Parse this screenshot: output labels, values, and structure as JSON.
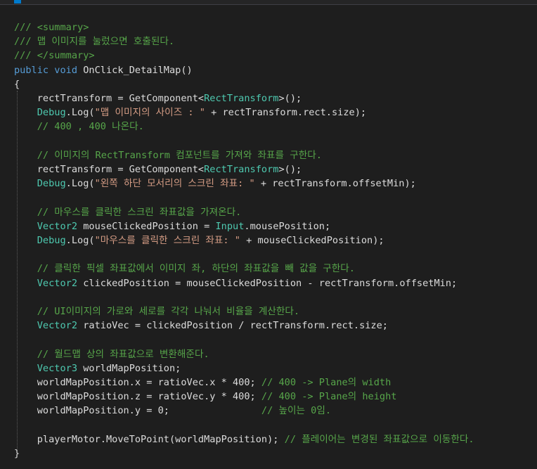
{
  "colors": {
    "background": "#1e1e1e",
    "plain": "#dcdcdc",
    "comment": "#57a64a",
    "keyword": "#569cd6",
    "type": "#4ec9b0",
    "string": "#d69d85"
  },
  "code": {
    "lines": [
      [
        {
          "c": "comment",
          "t": "/// <summary>"
        }
      ],
      [
        {
          "c": "comment",
          "t": "/// 맵 이미지를 눌렀으면 호출된다."
        }
      ],
      [
        {
          "c": "comment",
          "t": "/// </summary>"
        }
      ],
      [
        {
          "c": "keyword",
          "t": "public"
        },
        {
          "c": "plain",
          "t": " "
        },
        {
          "c": "keyword",
          "t": "void"
        },
        {
          "c": "plain",
          "t": " OnClick_DetailMap()"
        }
      ],
      [
        {
          "c": "plain",
          "t": "{"
        }
      ],
      [
        {
          "c": "plain",
          "t": "    rectTransform = GetComponent<"
        },
        {
          "c": "type",
          "t": "RectTransform"
        },
        {
          "c": "plain",
          "t": ">();"
        }
      ],
      [
        {
          "c": "plain",
          "t": "    "
        },
        {
          "c": "type",
          "t": "Debug"
        },
        {
          "c": "plain",
          "t": ".Log("
        },
        {
          "c": "string",
          "t": "\"맵 이미지의 사이즈 : \""
        },
        {
          "c": "plain",
          "t": " + rectTransform.rect.size);"
        }
      ],
      [
        {
          "c": "plain",
          "t": "    "
        },
        {
          "c": "comment",
          "t": "// 400 , 400 나온다."
        }
      ],
      [],
      [
        {
          "c": "plain",
          "t": "    "
        },
        {
          "c": "comment",
          "t": "// 이미지의 RectTransform 컴포넌트를 가져와 좌표를 구한다."
        }
      ],
      [
        {
          "c": "plain",
          "t": "    rectTransform = GetComponent<"
        },
        {
          "c": "type",
          "t": "RectTransform"
        },
        {
          "c": "plain",
          "t": ">();"
        }
      ],
      [
        {
          "c": "plain",
          "t": "    "
        },
        {
          "c": "type",
          "t": "Debug"
        },
        {
          "c": "plain",
          "t": ".Log("
        },
        {
          "c": "string",
          "t": "\"왼쪽 하단 모서리의 스크린 좌표: \""
        },
        {
          "c": "plain",
          "t": " + rectTransform.offsetMin);"
        }
      ],
      [],
      [
        {
          "c": "plain",
          "t": "    "
        },
        {
          "c": "comment",
          "t": "// 마우스를 클릭한 스크린 좌표값을 가져온다."
        }
      ],
      [
        {
          "c": "plain",
          "t": "    "
        },
        {
          "c": "type",
          "t": "Vector2"
        },
        {
          "c": "plain",
          "t": " mouseClickedPosition = "
        },
        {
          "c": "type",
          "t": "Input"
        },
        {
          "c": "plain",
          "t": ".mousePosition;"
        }
      ],
      [
        {
          "c": "plain",
          "t": "    "
        },
        {
          "c": "type",
          "t": "Debug"
        },
        {
          "c": "plain",
          "t": ".Log("
        },
        {
          "c": "string",
          "t": "\"마우스를 클릭한 스크린 좌표: \""
        },
        {
          "c": "plain",
          "t": " + mouseClickedPosition);"
        }
      ],
      [],
      [
        {
          "c": "plain",
          "t": "    "
        },
        {
          "c": "comment",
          "t": "// 클릭한 픽셀 좌표값에서 이미지 좌, 하단의 좌표값을 빼 값을 구한다."
        }
      ],
      [
        {
          "c": "plain",
          "t": "    "
        },
        {
          "c": "type",
          "t": "Vector2"
        },
        {
          "c": "plain",
          "t": " clickedPosition = mouseClickedPosition - rectTransform.offsetMin;"
        }
      ],
      [],
      [
        {
          "c": "plain",
          "t": "    "
        },
        {
          "c": "comment",
          "t": "// UI이미지의 가로와 세로를 각각 나눠서 비율을 계산한다."
        }
      ],
      [
        {
          "c": "plain",
          "t": "    "
        },
        {
          "c": "type",
          "t": "Vector2"
        },
        {
          "c": "plain",
          "t": " ratioVec = clickedPosition / rectTransform.rect.size;"
        }
      ],
      [],
      [
        {
          "c": "plain",
          "t": "    "
        },
        {
          "c": "comment",
          "t": "// 월드맵 상의 좌표값으로 변환해준다."
        }
      ],
      [
        {
          "c": "plain",
          "t": "    "
        },
        {
          "c": "type",
          "t": "Vector3"
        },
        {
          "c": "plain",
          "t": " worldMapPosition;"
        }
      ],
      [
        {
          "c": "plain",
          "t": "    worldMapPosition.x = ratioVec.x * 400; "
        },
        {
          "c": "comment",
          "t": "// 400 -> Plane의 width"
        }
      ],
      [
        {
          "c": "plain",
          "t": "    worldMapPosition.z = ratioVec.y * 400; "
        },
        {
          "c": "comment",
          "t": "// 400 -> Plane의 height"
        }
      ],
      [
        {
          "c": "plain",
          "t": "    worldMapPosition.y = 0;                "
        },
        {
          "c": "comment",
          "t": "// 높이는 0임."
        }
      ],
      [],
      [
        {
          "c": "plain",
          "t": "    playerMotor.MoveToPoint(worldMapPosition); "
        },
        {
          "c": "comment",
          "t": "// 플레이어는 변경된 좌표값으로 이동한다."
        }
      ],
      [
        {
          "c": "plain",
          "t": "}"
        }
      ]
    ]
  }
}
